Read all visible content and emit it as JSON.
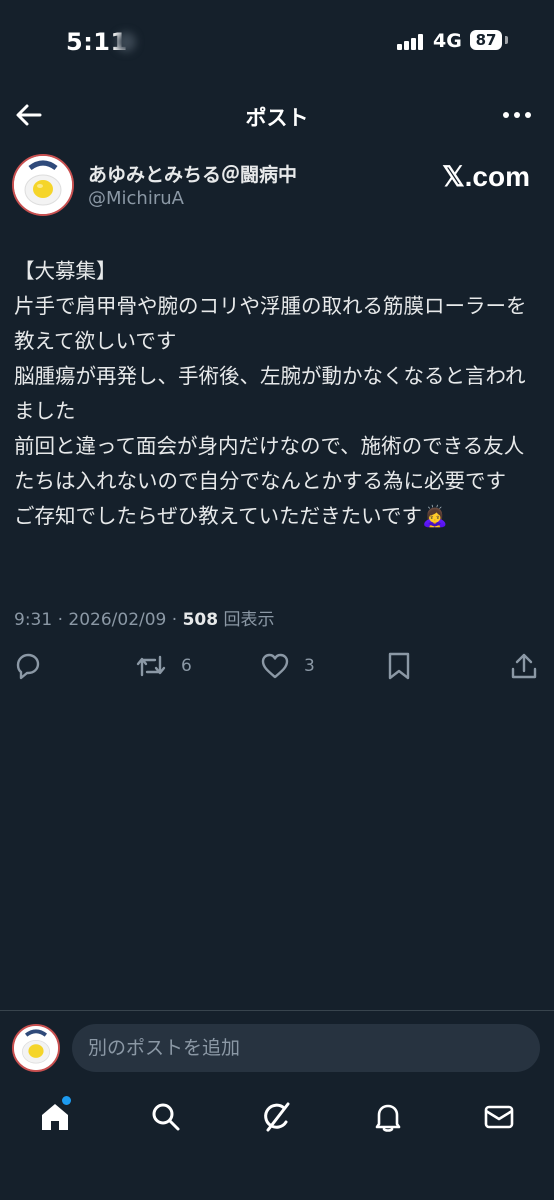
{
  "status_bar": {
    "time": "5:11",
    "network": "4G",
    "battery": "87"
  },
  "header": {
    "title": "ポスト"
  },
  "post": {
    "author_name": "あゆみとみちる＠闘病中",
    "author_handle": "@MichiruA",
    "source_badge": "𝕏.com",
    "lines": [
      "【大募集】",
      "片手で肩甲骨や腕のコリや浮腫の取れる筋膜ローラーを教えて欲しいです",
      "脳腫瘍が再発し、手術後、左腕が動かなくなると言われました",
      "前回と違って面会が身内だけなので、施術のできる友人たちは入れないので自分でなんとかする為に必要です",
      "ご存知でしたらぜひ教えていただきたいです🙇‍♀️"
    ],
    "meta_time": "9:31 · 2026/02/09 · ",
    "views_count": "508",
    "views_label": " 回表示",
    "retweets": "6",
    "likes": "3"
  },
  "composer": {
    "placeholder": "別のポストを追加"
  },
  "icons": {
    "back": "back-arrow-icon",
    "more": "more-dots-icon",
    "reply": "reply-icon",
    "retweet": "retweet-icon",
    "like": "heart-icon",
    "bookmark": "bookmark-icon",
    "share": "share-icon",
    "home": "home-icon",
    "search": "search-icon",
    "grok": "grok-icon",
    "notifications": "bell-icon",
    "messages": "mail-icon"
  },
  "colors": {
    "background": "#15202b",
    "text": "#e7e9ea",
    "muted": "#8b98a5",
    "accent": "#1d9bf0"
  }
}
